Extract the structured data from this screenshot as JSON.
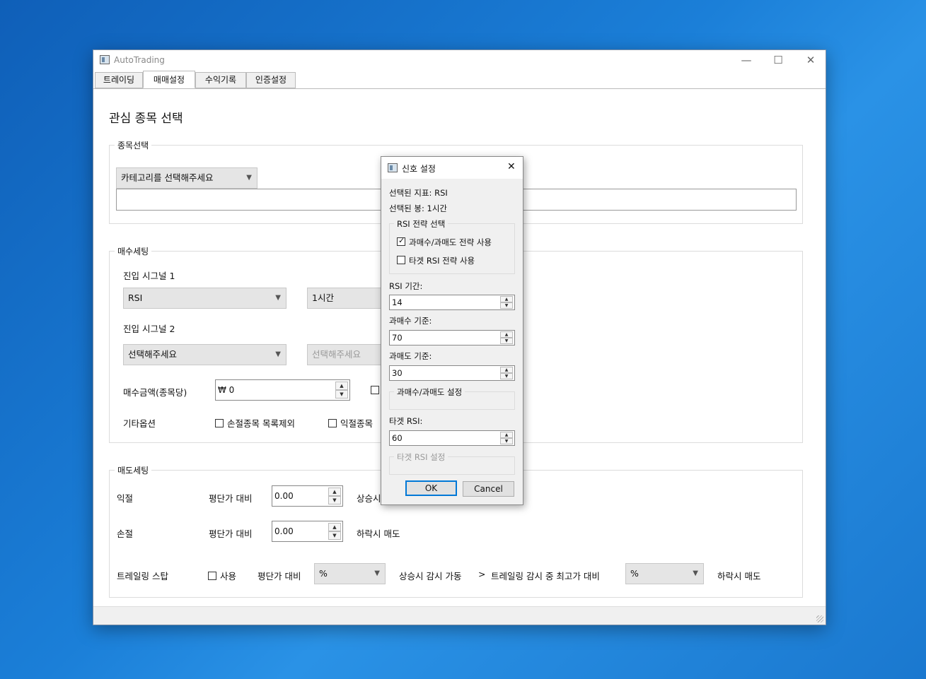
{
  "window": {
    "title": "AutoTrading",
    "minimize": "—",
    "maximize": "☐",
    "close": "✕"
  },
  "tabs": [
    {
      "label": "트레이딩"
    },
    {
      "label": "매매설정"
    },
    {
      "label": "수익기록"
    },
    {
      "label": "인증설정"
    }
  ],
  "main": {
    "heading": "관심 종목 선택",
    "stock_group": {
      "label": "종목선택",
      "category_combo": "카테고리를 선택해주세요"
    },
    "buy_group": {
      "label": "매수세팅",
      "signal1_label": "진입 시그널 1",
      "signal1_indicator": "RSI",
      "signal1_period": "1시간",
      "signal2_label": "진입 시그널 2",
      "signal2_indicator": "선택해주세요",
      "signal2_period": "선택해주세요",
      "amount_label": "매수금액(종목당)",
      "amount_value": "₩ 0",
      "other_label": "기타옵션",
      "opt_exclude_loss": "손절종목 목록제외",
      "opt_exclude_profit": "익절종목"
    },
    "sell_group": {
      "label": "매도세팅",
      "profit_label": "익절",
      "profit_vs": "평단가 대비",
      "profit_value": "0.00",
      "profit_suffix": "상승시",
      "loss_label": "손절",
      "loss_vs": "평단가 대비",
      "loss_value": "0.00",
      "loss_suffix": "하락시 매도",
      "trailing_label": "트레일링 스탑",
      "trailing_use": "사용",
      "trailing_vs": "평단가 대비",
      "trailing_unit1": "%",
      "trailing_mid": "상승시 감시 가동",
      "trailing_arrow": ">",
      "trailing_mid2": "트레일링 감시 중 최고가 대비",
      "trailing_unit2": "%",
      "trailing_suffix": "하락시 매도"
    }
  },
  "dialog": {
    "title": "신호 설정",
    "close": "✕",
    "selected_indicator": "선택된 지표: RSI",
    "selected_candle": "선택된 봉: 1시간",
    "strategy_group": "RSI 전략 선택",
    "opt_overbought": "과매수/과매도 전략 사용",
    "opt_overbought_checked": true,
    "opt_target": "타겟 RSI 전략 사용",
    "opt_target_checked": false,
    "rsi_period_label": "RSI 기간:",
    "rsi_period_value": "14",
    "overbought_label": "과매수 기준:",
    "overbought_value": "70",
    "oversold_label": "과매도 기준:",
    "oversold_value": "30",
    "ob_settings_group": "과매수/과매도 설정",
    "target_label": "타겟 RSI:",
    "target_value": "60",
    "target_settings_group": "타겟 RSI 설정",
    "ok": "OK",
    "cancel": "Cancel"
  }
}
